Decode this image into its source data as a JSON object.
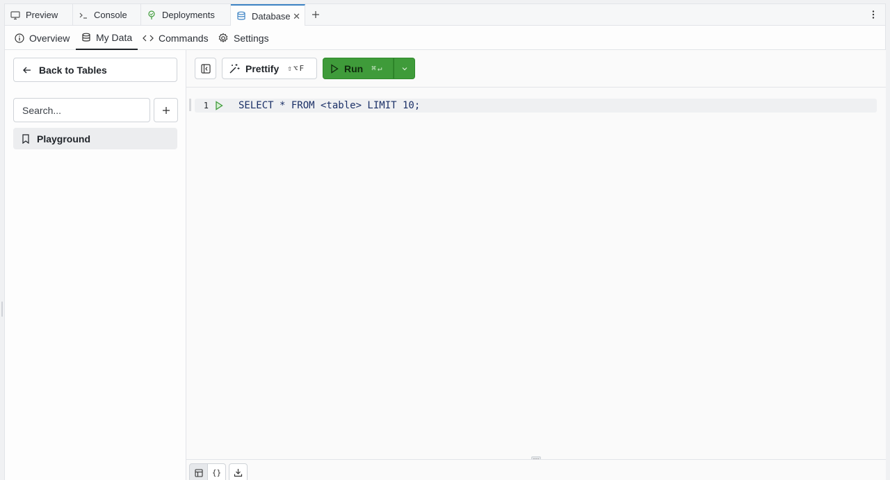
{
  "tabs": [
    {
      "label": "Preview",
      "icon": "monitor-icon"
    },
    {
      "label": "Console",
      "icon": "terminal-icon"
    },
    {
      "label": "Deployments",
      "icon": "tree-icon"
    },
    {
      "label": "Database",
      "icon": "database-icon",
      "active": true
    }
  ],
  "subnav": {
    "overview": "Overview",
    "my_data": "My Data",
    "commands": "Commands",
    "settings": "Settings"
  },
  "sidebar": {
    "back_label": "Back to Tables",
    "search_placeholder": "Search...",
    "saved_queries": [
      {
        "label": "Playground"
      }
    ]
  },
  "toolbar": {
    "prettify_label": "Prettify",
    "prettify_shortcut": "⇧⌥F",
    "run_label": "Run",
    "run_shortcut": "⌘↵"
  },
  "editor": {
    "line_number": "1",
    "code": "SELECT * FROM <table> LIMIT 10;"
  },
  "bottom": {
    "json_label": "{}"
  },
  "colors": {
    "run_green": "#3f9b3a",
    "active_tab_accent": "#3b82c4",
    "code_text": "#1a2f66"
  }
}
